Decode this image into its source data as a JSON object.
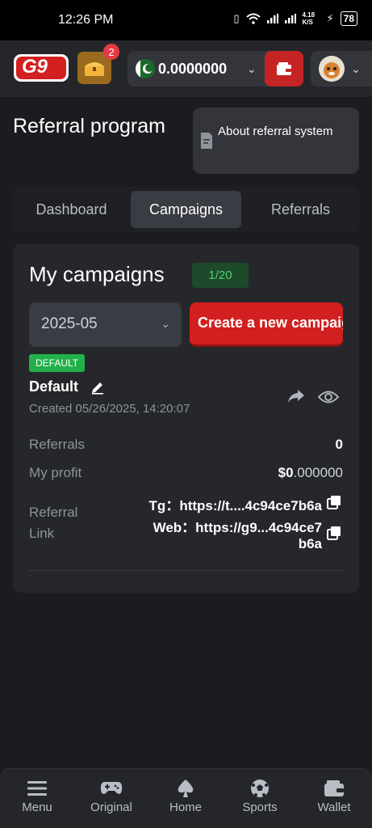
{
  "status_bar": {
    "time": "12:26 PM",
    "net_speed": "4.18 K/S",
    "battery": "78"
  },
  "header": {
    "logo_text": "G9",
    "chest_badge_count": "2",
    "balance": "0.0000000",
    "brand_color": "#d21f1f"
  },
  "page": {
    "title": "Referral program",
    "about_label": "About referral system"
  },
  "tabs": [
    {
      "label": "Dashboard",
      "active": false
    },
    {
      "label": "Campaigns",
      "active": true
    },
    {
      "label": "Referrals",
      "active": false
    }
  ],
  "campaigns": {
    "title": "My campaigns",
    "count": "1/20",
    "month_select": "2025-05",
    "create_label": "Create a new campaign",
    "item": {
      "badge": "DEFAULT",
      "name": "Default",
      "created": "Created 05/26/2025, 14:20:07",
      "referrals_label": "Referrals",
      "referrals_value": "0",
      "profit_label": "My profit",
      "profit_currency": "$",
      "profit_int": "0",
      "profit_dec": ".000000",
      "link_label_1": "Referral",
      "link_label_2": "Link",
      "tg_link": "Tg：https://t....4c94ce7b6a",
      "web_link_1": "Web：https://g9...4c94ce7",
      "web_link_2": "b6a"
    }
  },
  "bottom_nav": [
    {
      "label": "Menu",
      "icon": "menu-icon"
    },
    {
      "label": "Original",
      "icon": "gamepad-icon"
    },
    {
      "label": "Home",
      "icon": "spade-icon"
    },
    {
      "label": "Sports",
      "icon": "soccer-ball-icon"
    },
    {
      "label": "Wallet",
      "icon": "wallet-icon"
    }
  ]
}
